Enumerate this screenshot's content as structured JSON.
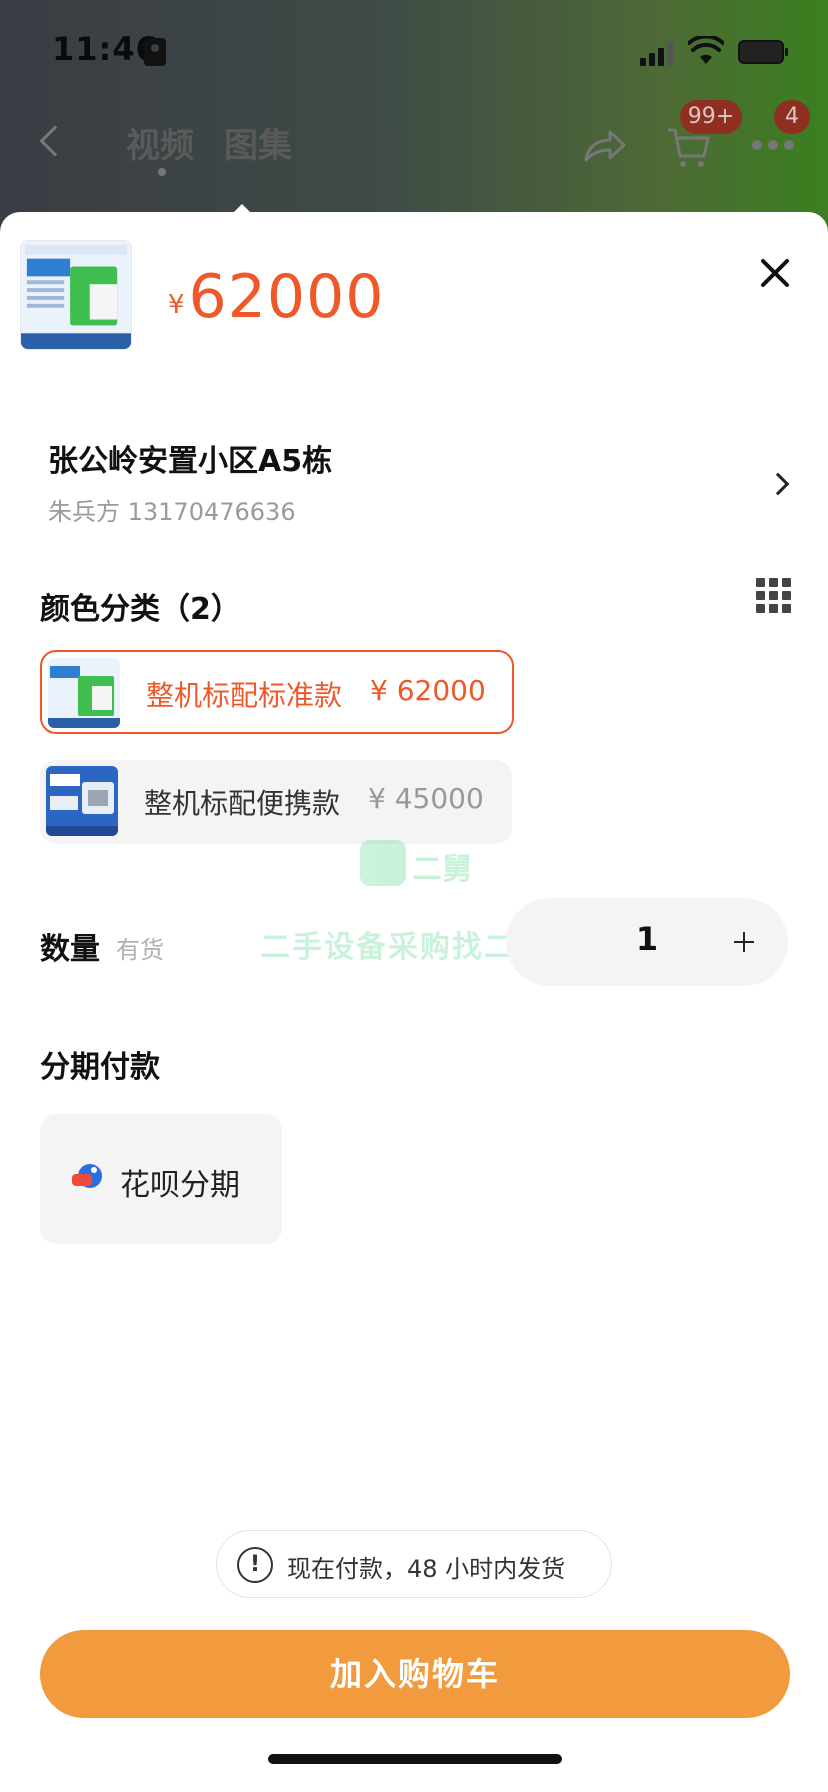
{
  "status_bar": {
    "time": "11:46"
  },
  "nav": {
    "tabs": [
      {
        "label": "视频"
      },
      {
        "label": "图集"
      }
    ],
    "cart_badge": "99+",
    "more_badge": "4",
    "icons": [
      "back-icon",
      "share-icon",
      "cart-icon",
      "more-icon"
    ]
  },
  "product": {
    "currency": "¥",
    "price": "62000"
  },
  "address": {
    "title": "张公岭安置小区A5栋",
    "contact": "朱兵方 13170476636"
  },
  "color_section": {
    "title": "颜色分类（2）",
    "variants": [
      {
        "name": "整机标配标准款",
        "price": "¥ 62000",
        "selected": true
      },
      {
        "name": "整机标配便携款",
        "price": "¥ 45000",
        "selected": false
      }
    ]
  },
  "watermark": {
    "name": "二舅",
    "slogan": "二手设备采购找二舅"
  },
  "quantity": {
    "label": "数量",
    "stock": "有货",
    "value": "1"
  },
  "installment": {
    "title": "分期付款",
    "option": "花呗分期"
  },
  "notice": {
    "text": "现在付款，48 小时内发货"
  },
  "cta": {
    "label": "加入购物车"
  },
  "colors": {
    "accent": "#f0582a",
    "button": "#f19a3e"
  }
}
